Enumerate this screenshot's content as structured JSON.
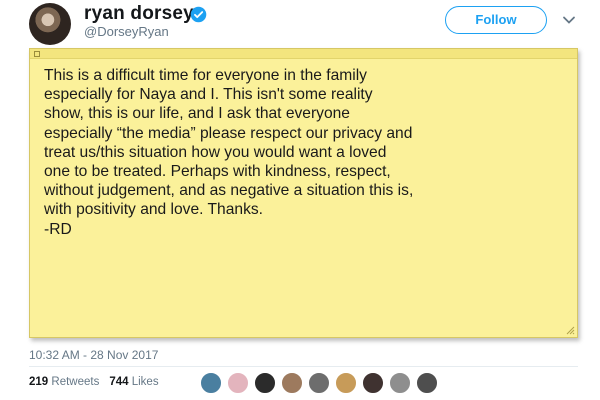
{
  "user": {
    "display_name": "ryan dorsey",
    "handle": "@DorseyRyan"
  },
  "actions": {
    "follow_label": "Follow"
  },
  "tweet": {
    "note_text": "This is a difficult time for everyone in the family\nespecially for Naya and I. This isn't some reality\nshow, this is our life, and I ask that everyone\nespecially “the media” please respect our privacy and\ntreat us/this situation how you would want a loved\none to be treated. Perhaps with kindness, respect,\nwithout judgement, and as negative a situation this is,\nwith positivity and love. Thanks.\n-RD",
    "timestamp": "10:32 AM - 28 Nov 2017"
  },
  "stats": {
    "retweets_count": "219",
    "retweets_label": "Retweets",
    "likes_count": "744",
    "likes_label": "Likes"
  },
  "colors": {
    "accent": "#1da1f2",
    "note_background": "#fbf19a",
    "muted_text": "#657786"
  },
  "likers": [
    {
      "name": "liker-avatar-1",
      "color": "#4a7fa0"
    },
    {
      "name": "liker-avatar-2",
      "color": "#e3b4bd"
    },
    {
      "name": "liker-avatar-3",
      "color": "#2b2b2b"
    },
    {
      "name": "liker-avatar-4",
      "color": "#9d7a5e"
    },
    {
      "name": "liker-avatar-5",
      "color": "#6d6d6d"
    },
    {
      "name": "liker-avatar-6",
      "color": "#c79b59"
    },
    {
      "name": "liker-avatar-7",
      "color": "#3f3230"
    },
    {
      "name": "liker-avatar-8",
      "color": "#8e8e8e"
    },
    {
      "name": "liker-avatar-9",
      "color": "#4e4e4e"
    }
  ]
}
